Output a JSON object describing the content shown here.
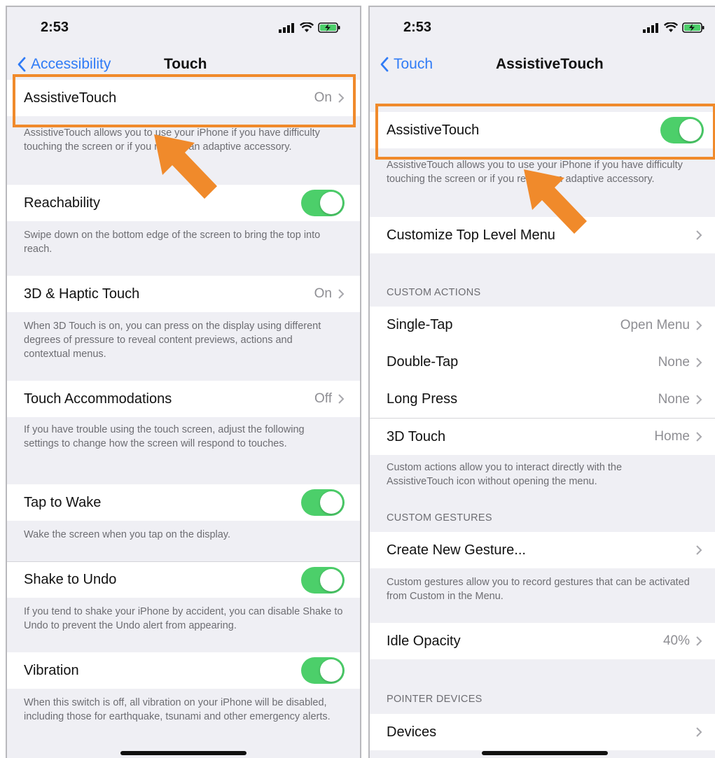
{
  "colors": {
    "accent_blue": "#2f7bf6",
    "toggle_green": "#4ccf6a",
    "highlight_orange": "#f08a2b",
    "background_gray": "#efeff4"
  },
  "left": {
    "status": {
      "time": "2:53"
    },
    "nav": {
      "back_label": "Accessibility",
      "title": "Touch"
    },
    "rows": [
      {
        "label": "AssistiveTouch",
        "value": "On",
        "footer": "AssistiveTouch allows you to use your iPhone if you have difficulty touching the screen or if you require an adaptive accessory."
      },
      {
        "label": "Reachability",
        "toggle": true,
        "footer": "Swipe down on the bottom edge of the screen to bring the top into reach."
      },
      {
        "label": "3D & Haptic Touch",
        "value": "On",
        "footer": "When 3D Touch is on, you can press on the display using different degrees of pressure to reveal content previews, actions and contextual menus."
      },
      {
        "label": "Touch Accommodations",
        "value": "Off",
        "footer": "If you have trouble using the touch screen, adjust the following settings to change how the screen will respond to touches."
      },
      {
        "label": "Tap to Wake",
        "toggle": true,
        "footer": "Wake the screen when you tap on the display."
      },
      {
        "label": "Shake to Undo",
        "toggle": true,
        "footer": "If you tend to shake your iPhone by accident, you can disable Shake to Undo to prevent the Undo alert from appearing."
      },
      {
        "label": "Vibration",
        "toggle": true,
        "footer": "When this switch is off, all vibration on your iPhone will be disabled, including those for earthquake, tsunami and other emergency alerts."
      }
    ]
  },
  "right": {
    "status": {
      "time": "2:53"
    },
    "nav": {
      "back_label": "Touch",
      "title": "AssistiveTouch"
    },
    "main": {
      "label": "AssistiveTouch",
      "toggle": true,
      "footer": "AssistiveTouch allows you to use your iPhone if you have difficulty touching the screen or if you require an adaptive accessory."
    },
    "customize": {
      "label": "Customize Top Level Menu"
    },
    "custom_actions": {
      "header": "CUSTOM ACTIONS",
      "rows": [
        {
          "label": "Single-Tap",
          "value": "Open Menu"
        },
        {
          "label": "Double-Tap",
          "value": "None"
        },
        {
          "label": "Long Press",
          "value": "None"
        },
        {
          "label": "3D Touch",
          "value": "Home"
        }
      ],
      "footer": "Custom actions allow you to interact directly with the AssistiveTouch icon without opening the menu."
    },
    "custom_gestures": {
      "header": "CUSTOM GESTURES",
      "create_label": "Create New Gesture...",
      "footer": "Custom gestures allow you to record gestures that can be activated from Custom in the Menu."
    },
    "idle_opacity": {
      "label": "Idle Opacity",
      "value": "40%"
    },
    "pointer_devices": {
      "header": "POINTER DEVICES",
      "devices_label": "Devices"
    }
  }
}
